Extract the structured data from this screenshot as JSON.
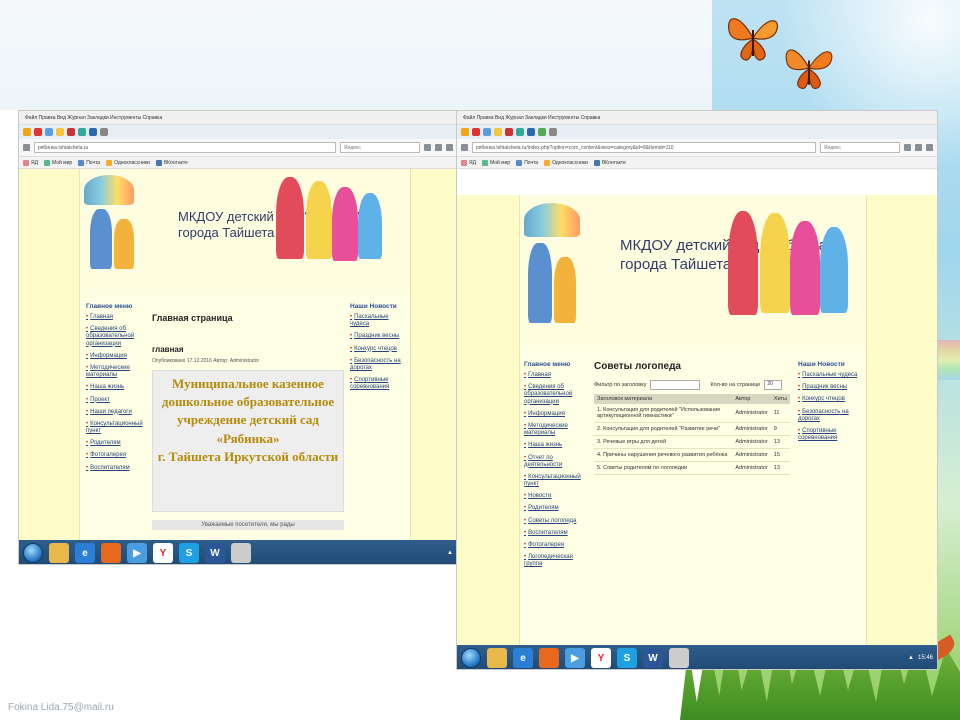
{
  "footer": {
    "email": "Fokina Lida.75@mail.ru"
  },
  "left_browser": {
    "menu_text": "Файл  Правка  Вид  Журнал  Закладки  Инструменты  Справка",
    "url": "рябинка.tshtaisheta.ru",
    "search_placeholder": "Яндекс",
    "site_title_line1": "МКДОУ детский сад \"Рябинка\"",
    "site_title_line2": "города Тайшета",
    "menu_header": "Главное меню",
    "menu_items": [
      "Главная",
      "Сведения об образовательной организации",
      "Информация",
      "Методические материалы",
      "Наша жизнь",
      "Проект",
      "Наши педагоги",
      "Консультационный пункт",
      "Родителям",
      "Фотогалерея",
      "Воспитателям"
    ],
    "news_header": "Наши Новости",
    "news_items": [
      "Пасхальные чудеса",
      "Праздник весны",
      "Конкурс чтецов",
      "Безопасность на дорогах",
      "Спортивные соревнования"
    ],
    "page_heading": "Главная страница",
    "sub_heading": "главная",
    "meta": "Опубликовано 17.12.2016  Автор: Administrator",
    "org_name_lines": [
      "Муниципальное казенное",
      "дошкольное образовательное",
      "учреждение детский сад",
      "«Рябинка»",
      "г. Тайшета Иркутской области"
    ],
    "notice": "Уважаемые посетители, мы рады"
  },
  "right_browser": {
    "menu_text": "Файл  Правка  Вид  Журнал  Закладки  Инструменты  Справка",
    "url": "рябинка.tshtaisheta.ru/index.php?option=com_content&view=category&id=8&Itemid=110",
    "search_placeholder": "Яндекс",
    "site_title_line1": "МКДОУ детский сад \"Рябинка\"",
    "site_title_line2": "города Тайшета",
    "menu_header": "Главное меню",
    "menu_items": [
      "Главная",
      "Сведения об образовательной организации",
      "Информация",
      "Методические материалы",
      "Наша жизнь",
      "Отчет по деятельности",
      "Консультационный пункт",
      "Новости",
      "Родителям",
      "Советы логопеда",
      "Воспитателям",
      "Фотогалерея",
      "Логопедическая группа"
    ],
    "news_header": "Наши Новости",
    "news_items": [
      "Пасхальные чудеса",
      "Праздник весны",
      "Конкурс чтецов",
      "Безопасность на дорогах",
      "Спортивные соревнования"
    ],
    "page_heading": "Советы логопеда",
    "filter_label": "Фильтр по заголовку",
    "display_label": "Кол-во на странице",
    "display_value": "20",
    "table_headers": [
      "Заголовок материала",
      "Автор",
      "Хиты"
    ],
    "rows": [
      {
        "title": "1. Консультация для родителей \"Использование артикуляционной гимнастики\"",
        "author": "Administrator",
        "hits": "11"
      },
      {
        "title": "2. Консультация для родителей \"Развитие речи\"",
        "author": "Administrator",
        "hits": "9"
      },
      {
        "title": "3. Речевые игры для детей",
        "author": "Administrator",
        "hits": "13"
      },
      {
        "title": "4. Причины нарушения речевого развития ребёнка",
        "author": "Administrator",
        "hits": "15"
      },
      {
        "title": "5. Советы родителям по логопедии",
        "author": "Administrator",
        "hits": "13"
      }
    ],
    "tray_time": "15:46"
  },
  "colors": {
    "accent": "#2a4f9a",
    "page_bg": "#fdfcc8",
    "taskbar": "#1f4a74",
    "org_text": "#b68b0a"
  }
}
